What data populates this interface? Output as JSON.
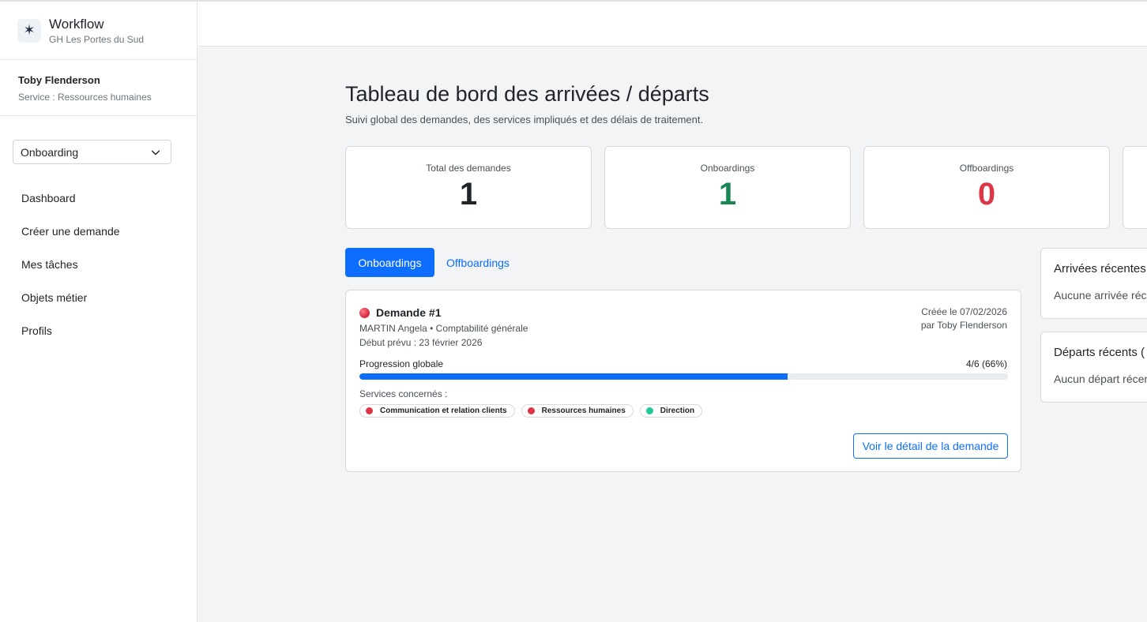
{
  "brand": {
    "title": "Workflow",
    "subtitle": "GH Les Portes du Sud",
    "logo_icon": "✶"
  },
  "user": {
    "name": "Toby Flenderson",
    "service": "Service : Ressources humaines"
  },
  "workflow_select": {
    "value": "Onboarding"
  },
  "nav": [
    {
      "label": "Dashboard"
    },
    {
      "label": "Créer une demande"
    },
    {
      "label": "Mes tâches"
    },
    {
      "label": "Objets métier"
    },
    {
      "label": "Profils"
    }
  ],
  "page": {
    "title": "Tableau de bord des arrivées / départs",
    "subtitle": "Suivi global des demandes, des services impliqués et des délais de traitement."
  },
  "stats": [
    {
      "label": "Total des demandes",
      "value": "1",
      "color": "#212529"
    },
    {
      "label": "Onboardings",
      "value": "1",
      "color": "#198754"
    },
    {
      "label": "Offboardings",
      "value": "0",
      "color": "#dc3545"
    }
  ],
  "tabs": {
    "active": "Onboardings",
    "inactive": "Offboardings"
  },
  "request": {
    "title": "Demande #1",
    "status_color": "#dc3545",
    "line1": "MARTIN Angela • Comptabilité générale",
    "line2": "Début prévu : 23 février 2026",
    "created_on": "Créée le 07/02/2026",
    "created_by": "par Toby Flenderson",
    "progress_label": "Progression globale",
    "progress_text": "4/6 (66%)",
    "progress_fraction": 0.66,
    "services_label": "Services concernés :",
    "services": [
      {
        "name": "Communication et relation clients",
        "color": "#dc3545"
      },
      {
        "name": "Ressources humaines",
        "color": "#dc3545"
      },
      {
        "name": "Direction",
        "color": "#20c997"
      }
    ],
    "detail_button": "Voir le détail de la demande"
  },
  "recent_arrivals": {
    "title": "Arrivées récentes",
    "empty": "Aucune arrivée réce"
  },
  "recent_departures": {
    "title": "Départs récents (",
    "empty": "Aucun départ récer"
  }
}
